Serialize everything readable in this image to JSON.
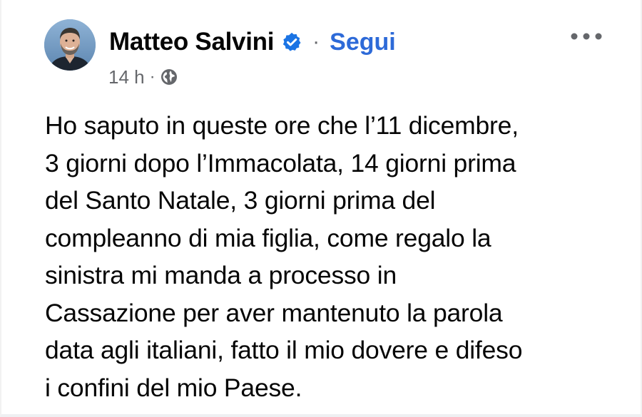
{
  "post": {
    "author": "Matteo Salvini",
    "verified": true,
    "separator": "·",
    "follow_label": "Segui",
    "timestamp": "14 h",
    "meta_separator": "·",
    "audience_icon": "globe-icon",
    "more_icon": "more-options-icon",
    "body_lines": [
      "Ho saputo in queste ore che l’11 dicembre,",
      "3 giorni dopo l’Immacolata, 14 giorni prima",
      "del Santo Natale, 3 giorni prima del",
      "compleanno di mia figlia, come regalo la",
      "sinistra mi manda a processo in",
      "Cassazione per aver mantenuto la parola",
      "data agli italiani, fatto il mio dovere e difeso",
      "i confini del mio Paese."
    ]
  },
  "colors": {
    "text": "#050505",
    "secondary": "#65676b",
    "link": "#2d6ad8",
    "verified_badge": "#1b74e4",
    "background": "#ffffff"
  }
}
